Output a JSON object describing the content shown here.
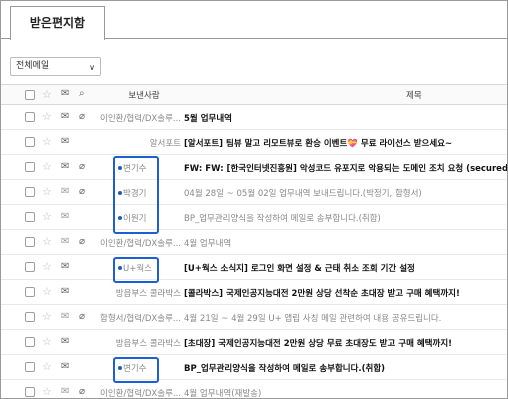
{
  "tabs": {
    "inbox": "받은편지함"
  },
  "filter": {
    "value": "전체메일",
    "arrow": "∨"
  },
  "header": {
    "sender": "보낸사람",
    "subject": "제목"
  },
  "icons": {
    "checkbox": "checkbox-icon",
    "star": "star-icon",
    "mail": "envelope-icon",
    "attachment": "paperclip-icon"
  },
  "highlight_color": "#1a5fd4",
  "rows": [
    {
      "sender": "이인환/협력/DX솔루...",
      "subject": "5월 업무내역",
      "read": false,
      "attach": true
    },
    {
      "sender": "알서포트",
      "subject": "[알서포트] 팀뷰 말고 리모트뷰로 환승 이벤트💝 무료 라이선스 받으세요~",
      "read": false,
      "attach": false
    },
    {
      "sender": "변기수",
      "subject": "FW: FW: [한국인터넷진흥원] 악성코드 유포지로 악용되는 도메인 조치 요청 (secured.uplusworks...",
      "read": false,
      "attach": true
    },
    {
      "sender": "박경기",
      "subject": "04월 28일 ~ 05월 02일 업무내역 보내드립니다.(박정기, 함형서)",
      "read": true,
      "attach": true
    },
    {
      "sender": "이원기",
      "subject": "BP_업무관리양식을 작성하여 메일로 송부합니다.(취합)",
      "read": true,
      "attach": false
    },
    {
      "sender": "이인환/협력/DX솔루...",
      "subject": "4월 업무내역",
      "read": true,
      "attach": true
    },
    {
      "sender": "U+웍스",
      "subject": "[U+웍스 소식지] 로그인 화면 설정 & 근태 취소 조회 기간 설정",
      "read": false,
      "attach": false
    },
    {
      "sender": "방읍부스 콜라박스",
      "subject": "[콜라박스] 국제인공지능대전 2만원 상당 선착순 초대장 받고 구매 혜택까지!",
      "read": false,
      "attach": false
    },
    {
      "sender": "함형서/협력/DX솔루...",
      "subject": "4월 21일 ~ 4월 29일 U+ 앱립 사칭 메일 관련하여 내용 공유드립니다.",
      "read": true,
      "attach": true
    },
    {
      "sender": "방읍부스 콜라박스",
      "subject": "[초대장] 국제인공지능대전 2만원 상당 무료 초대장도 받고 구매 혜택까지!",
      "read": false,
      "attach": false
    },
    {
      "sender": "변기수",
      "subject": "BP_업무관리양식을 작성하여 메일로 송부합니다.(취합)",
      "read": false,
      "attach": false
    },
    {
      "sender": "이인환/협력/DX솔루...",
      "subject": "4월 업무내역(재발송)",
      "read": true,
      "attach": true
    }
  ]
}
